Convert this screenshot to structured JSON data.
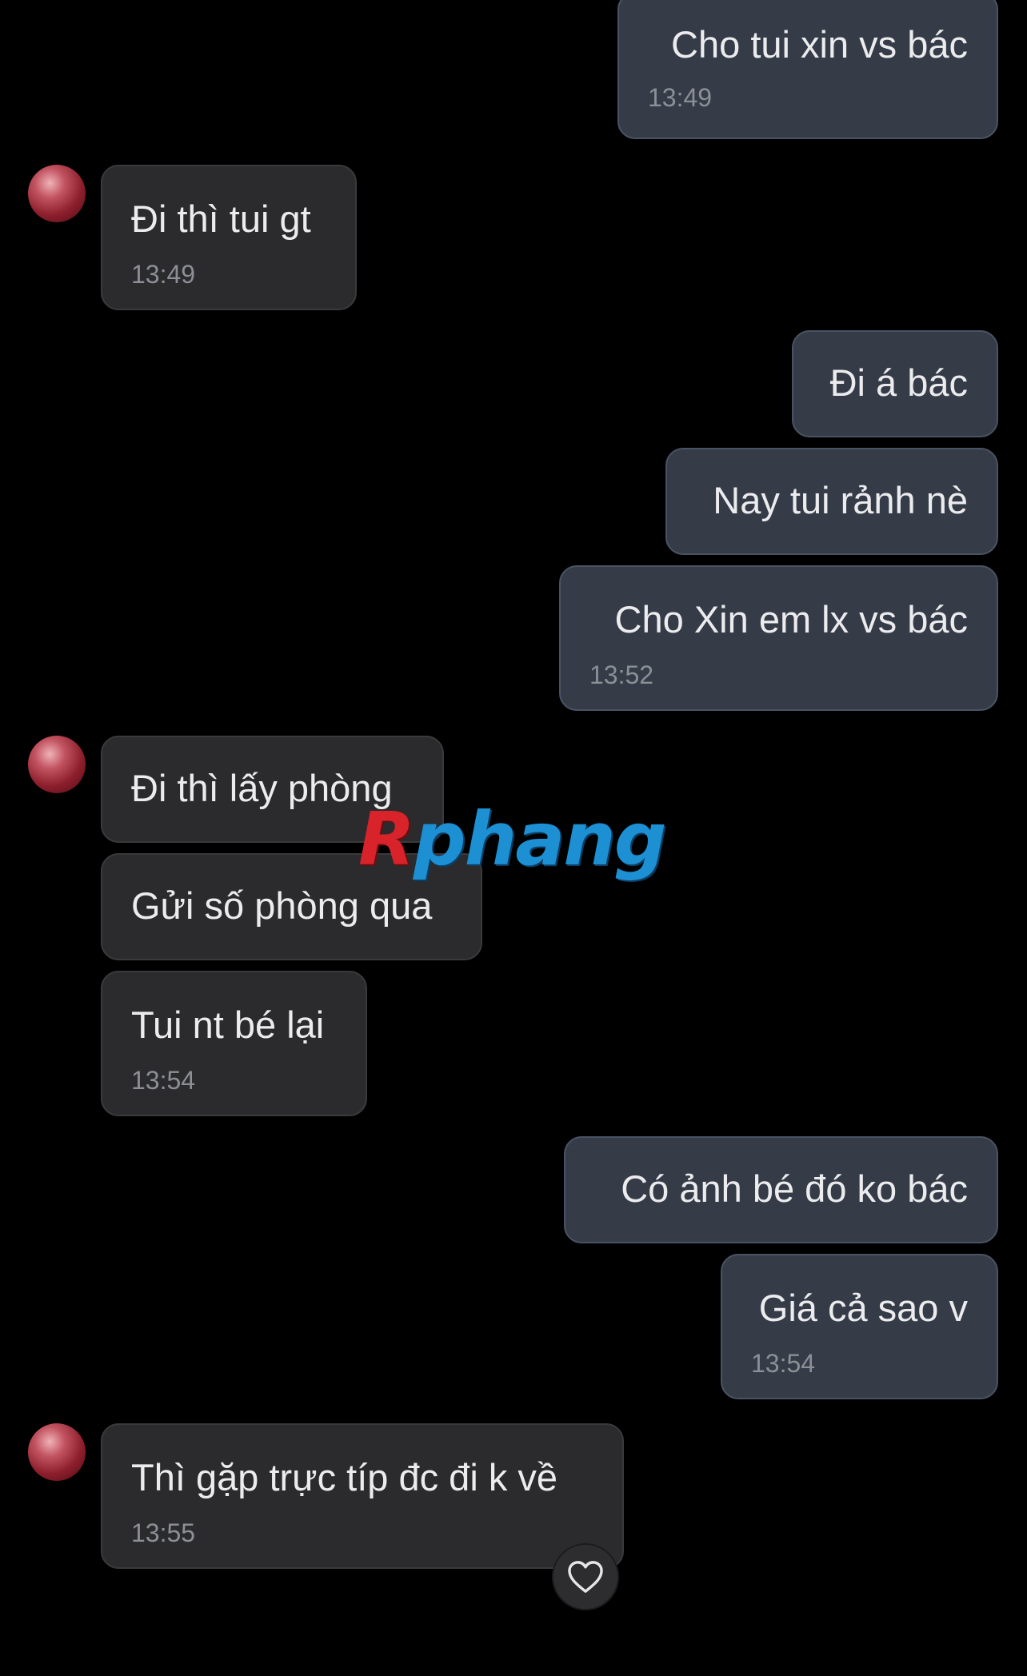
{
  "messages": [
    {
      "side": "out",
      "text": "Cho tui xin vs bác",
      "time": "13:49"
    },
    {
      "side": "in",
      "text": "Đi thì tui gt",
      "time": "13:49"
    },
    {
      "side": "out",
      "text": "Đi á bác"
    },
    {
      "side": "out",
      "text": "Nay tui rảnh nè"
    },
    {
      "side": "out",
      "text": "Cho Xin em lx vs bác",
      "time": "13:52"
    },
    {
      "side": "in",
      "text": "Đi thì lấy phòng"
    },
    {
      "side": "in",
      "text": "Gửi số phòng qua"
    },
    {
      "side": "in",
      "text": "Tui nt bé lại",
      "time": "13:54"
    },
    {
      "side": "out",
      "text": "Có ảnh bé đó ko bác"
    },
    {
      "side": "out",
      "text": "Giá cả sao v",
      "time": "13:54"
    },
    {
      "side": "in",
      "text": "Thì gặp trực típ đc đi k về",
      "time": "13:55"
    }
  ],
  "watermark": {
    "first": "R",
    "rest": "phang"
  },
  "reaction": {
    "icon": "heart-outline-icon"
  },
  "colors": {
    "background": "#000000",
    "incoming_bubble": "#2b2b2d",
    "outgoing_bubble": "#353c48",
    "timestamp": "#8c8f95",
    "watermark_red": "#d8232a",
    "watermark_blue": "#1d8fd3"
  }
}
